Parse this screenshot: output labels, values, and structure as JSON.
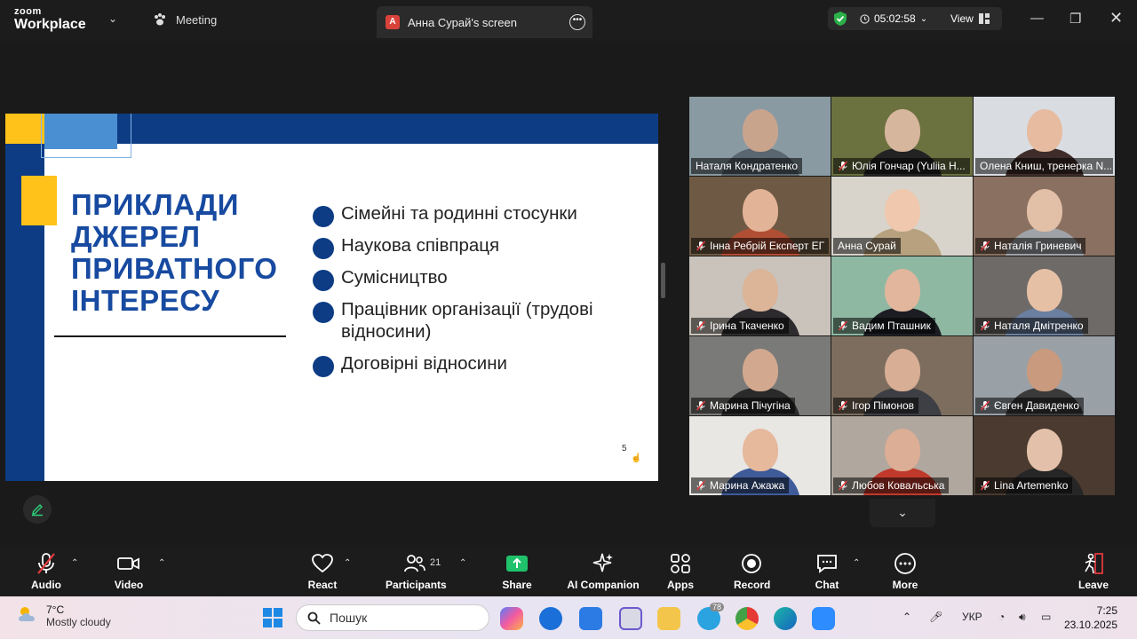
{
  "titlebar": {
    "logo_line1": "zoom",
    "logo_line2": "Workplace",
    "meeting_label": "Meeting",
    "screen_tab_badge": "A",
    "screen_tab_label": "Анна Сурай's screen",
    "timer": "05:02:58",
    "view_label": "View"
  },
  "slide": {
    "heading": "ПРИКЛАДИ ДЖЕРЕЛ ПРИВАТНОГО ІНТЕРЕСУ",
    "bullets": [
      "Сімейні та родинні стосунки",
      "Наукова співпраця",
      "Сумісництво",
      "Працівник організації (трудові відносини)",
      "Договірні відносини"
    ],
    "page_number": "5",
    "colors": {
      "navy": "#0d3c85",
      "yellow": "#ffc21a",
      "light_blue": "#4a8fd1",
      "heading": "#174aa0"
    }
  },
  "participants": [
    {
      "name": "Наталя Кондратенко",
      "muted": false,
      "active": true
    },
    {
      "name": "Юлія Гончар (Yuliia H...",
      "muted": true,
      "active": false
    },
    {
      "name": "Олена Книш, тренерка N...",
      "muted": false,
      "active": false
    },
    {
      "name": "Інна Ребрій Експерт ЕГ",
      "muted": true,
      "active": false
    },
    {
      "name": "Анна Сурай",
      "muted": false,
      "active": false
    },
    {
      "name": "Наталія Гриневич",
      "muted": true,
      "active": false
    },
    {
      "name": "Ірина Ткаченко",
      "muted": true,
      "active": false
    },
    {
      "name": "Вадим Пташник",
      "muted": true,
      "active": false
    },
    {
      "name": "Наталя Дмітренко",
      "muted": true,
      "active": false
    },
    {
      "name": "Марина Пічугіна",
      "muted": true,
      "active": false
    },
    {
      "name": "Ігор Пімонов",
      "muted": true,
      "active": false
    },
    {
      "name": "Євген Давиденко",
      "muted": true,
      "active": false
    },
    {
      "name": "Марина Ажажа",
      "muted": true,
      "active": false
    },
    {
      "name": "Любов Ковальська",
      "muted": true,
      "active": false
    },
    {
      "name": "Lina Artemenko",
      "muted": true,
      "active": false
    }
  ],
  "toolbar": {
    "audio": "Audio",
    "video": "Video",
    "react": "React",
    "participants": "Participants",
    "participants_count": "21",
    "share": "Share",
    "ai_companion": "AI Companion",
    "apps": "Apps",
    "record": "Record",
    "chat": "Chat",
    "more": "More",
    "leave": "Leave"
  },
  "taskbar": {
    "temperature": "7°C",
    "weather": "Mostly cloudy",
    "search_placeholder": "Пошук",
    "telegram_badge": "78",
    "language": "УКР",
    "time": "7:25",
    "date": "23.10.2025"
  }
}
